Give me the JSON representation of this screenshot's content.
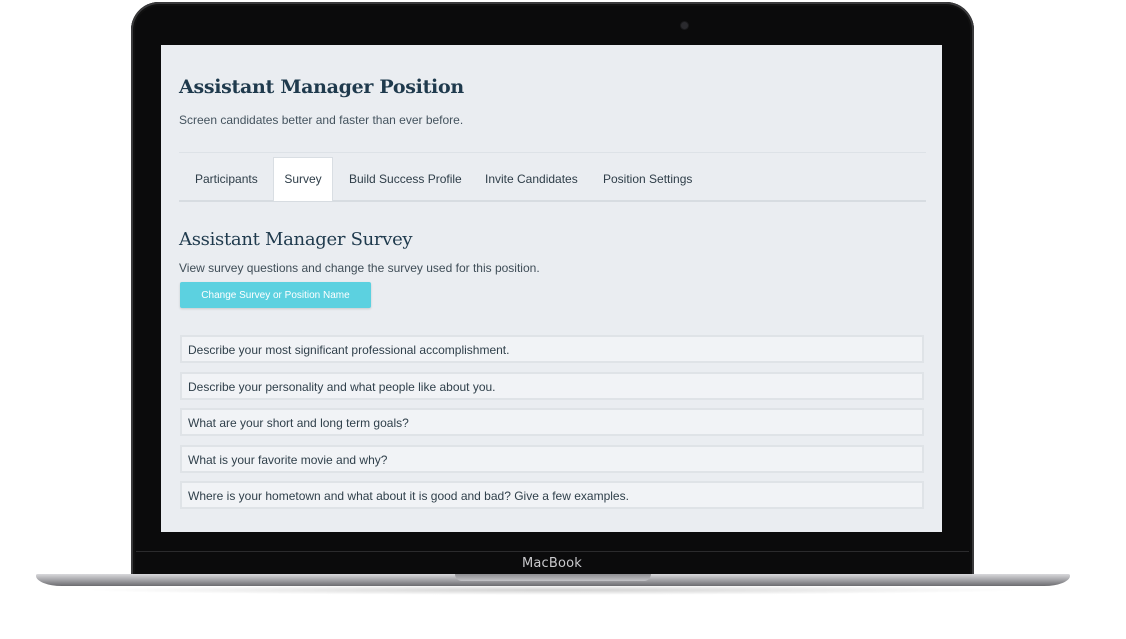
{
  "device": {
    "brand_label": "MacBook"
  },
  "page": {
    "title": "Assistant Manager Position",
    "subtitle": "Screen candidates better and faster than ever before."
  },
  "tabs": [
    {
      "label": "Participants",
      "active": false
    },
    {
      "label": "Survey",
      "active": true
    },
    {
      "label": "Build Success Profile",
      "active": false
    },
    {
      "label": "Invite Candidates",
      "active": false
    },
    {
      "label": "Position Settings",
      "active": false
    }
  ],
  "survey": {
    "title": "Assistant Manager Survey",
    "description": "View survey questions and change the survey used for this position.",
    "change_button_label": "Change Survey or Position Name",
    "questions": [
      "Describe your most significant professional accomplishment.",
      "Describe your personality and what people like about you.",
      "What are your short and long term goals?",
      "What is your favorite movie and why?",
      "Where is your hometown and what about it is good and bad? Give a few examples."
    ]
  },
  "colors": {
    "accent": "#5cd1e0",
    "heading": "#1f3a4d",
    "screen_background": "#eaedf1"
  }
}
